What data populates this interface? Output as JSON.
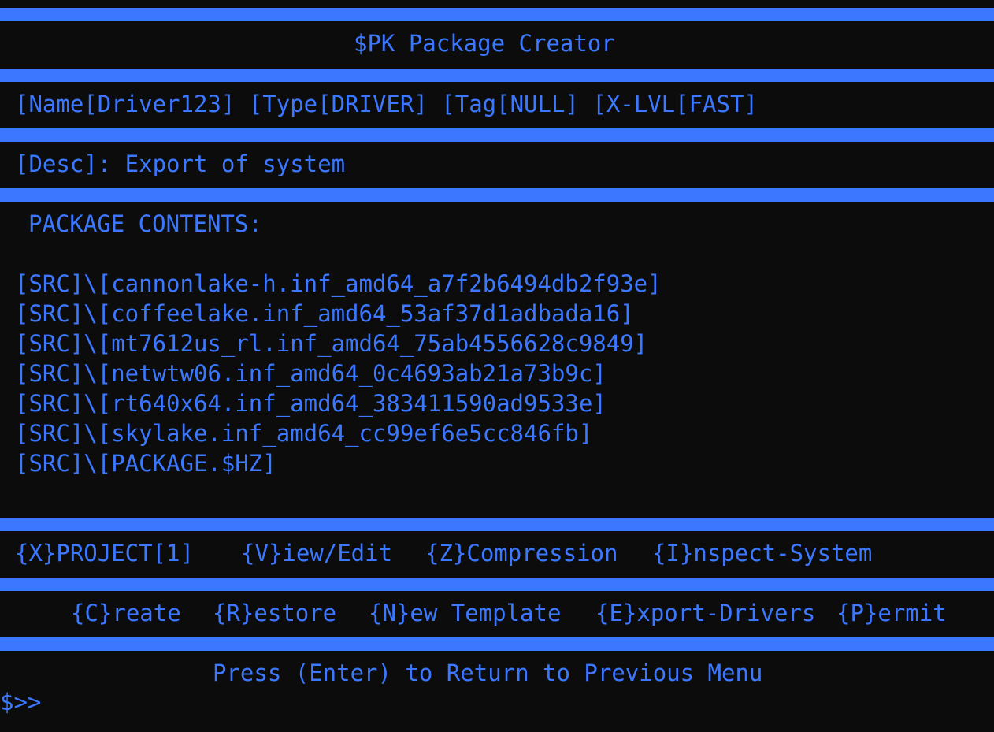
{
  "title": "$PK Package Creator",
  "info": {
    "name": "[Name[Driver123]",
    "type": "[Type[DRIVER]",
    "tag": "[Tag[NULL]",
    "xlvl": "[X-LVL[FAST]"
  },
  "description": "[Desc]: Export of system",
  "contents_header": "PACKAGE CONTENTS:",
  "contents": [
    "[SRC]\\[cannonlake-h.inf_amd64_a7f2b6494db2f93e]",
    "[SRC]\\[coffeelake.inf_amd64_53af37d1adbada16]",
    "[SRC]\\[mt7612us_rl.inf_amd64_75ab4556628c9849]",
    "[SRC]\\[netwtw06.inf_amd64_0c4693ab21a73b9c]",
    "[SRC]\\[rt640x64.inf_amd64_383411590ad9533e]",
    "[SRC]\\[skylake.inf_amd64_cc99ef6e5cc846fb]",
    "[SRC]\\[PACKAGE.$HZ]"
  ],
  "menu_row1": {
    "project": "{X}PROJECT[1]",
    "view_edit": "{V}iew/Edit",
    "compression": "{Z}Compression",
    "inspect": "{I}nspect-System"
  },
  "menu_row2": {
    "create": "{C}reate",
    "restore": "{R}estore",
    "new_template": "{N}ew Template",
    "export_drivers": "{E}xport-Drivers",
    "permit": "{P}ermit"
  },
  "footer_hint": "Press (Enter) to Return to Previous Menu",
  "prompt": "$>>"
}
